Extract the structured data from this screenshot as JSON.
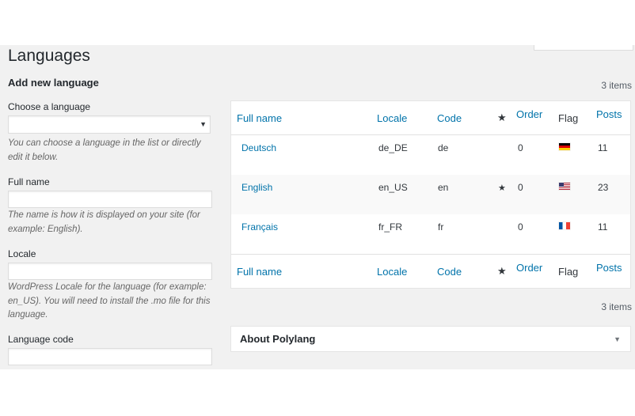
{
  "page": {
    "title": "Languages"
  },
  "form": {
    "heading": "Add new language",
    "choose_label": "Choose a language",
    "choose_value": "",
    "choose_help": "You can choose a language in the list or directly edit it below.",
    "fullname_label": "Full name",
    "fullname_value": "",
    "fullname_help": "The name is how it is displayed on your site (for example: English).",
    "locale_label": "Locale",
    "locale_value": "",
    "locale_help": "WordPress Locale for the language (for example: en_US). You will need to install the .mo file for this language.",
    "code_label": "Language code",
    "code_value": ""
  },
  "table": {
    "items_count": "3 items",
    "columns": {
      "full_name": "Full name",
      "locale": "Locale",
      "code": "Code",
      "star": "★",
      "order": "Order",
      "flag": "Flag",
      "posts": "Posts"
    },
    "rows": [
      {
        "name": "Deutsch",
        "locale": "de_DE",
        "code": "de",
        "default": "",
        "order": "0",
        "flag_icon": "flag-de-icon",
        "posts": "11"
      },
      {
        "name": "English",
        "locale": "en_US",
        "code": "en",
        "default": "★",
        "order": "0",
        "flag_icon": "flag-us-icon",
        "posts": "23"
      },
      {
        "name": "Français",
        "locale": "fr_FR",
        "code": "fr",
        "default": "",
        "order": "0",
        "flag_icon": "flag-fr-icon",
        "posts": "11"
      }
    ]
  },
  "about": {
    "title": "About Polylang",
    "toggle_icon": "caret-down-icon"
  },
  "icons": {
    "select_arrow": "▼",
    "about_arrow": "▼"
  },
  "colors": {
    "link": "#0073aa",
    "background": "#f1f1f1",
    "text": "#23282d"
  }
}
